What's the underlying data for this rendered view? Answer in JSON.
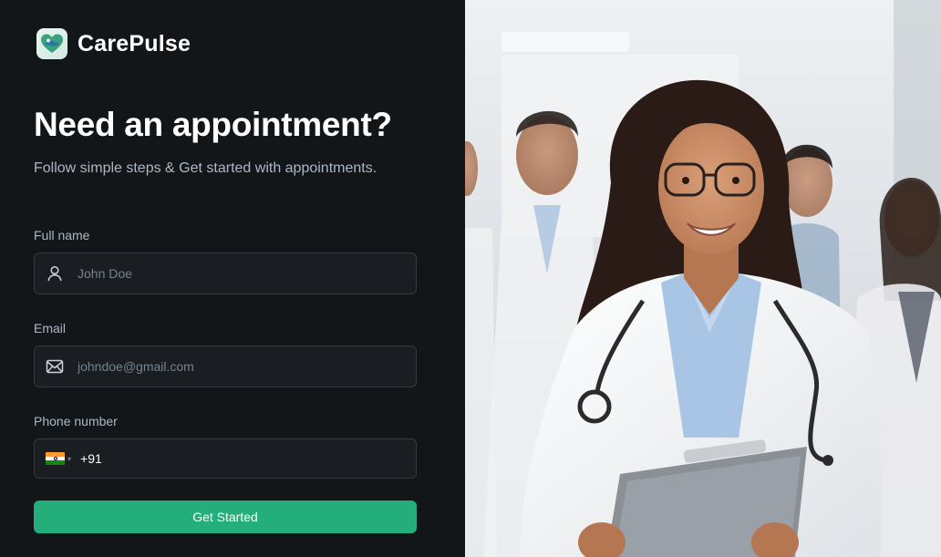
{
  "brand": {
    "name": "CarePulse",
    "accent_color": "#24ae7c"
  },
  "heading": {
    "title": "Need an appointment?",
    "subtitle": "Follow simple steps & Get started with appointments."
  },
  "form": {
    "full_name": {
      "label": "Full name",
      "placeholder": "John Doe",
      "icon": "user-icon"
    },
    "email": {
      "label": "Email",
      "placeholder": "johndoe@gmail.com",
      "icon": "mail-icon"
    },
    "phone": {
      "label": "Phone number",
      "country_flag": "india-flag-icon",
      "dial_code": "+91"
    },
    "submit_label": "Get Started"
  },
  "hero_image": {
    "subject": "doctor-photo"
  }
}
